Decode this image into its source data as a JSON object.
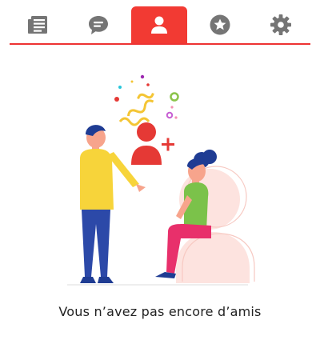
{
  "tabs": [
    {
      "id": "news",
      "icon": "newspaper-icon",
      "active": false
    },
    {
      "id": "messages",
      "icon": "chat-bubble-icon",
      "active": false
    },
    {
      "id": "friends",
      "icon": "user-icon",
      "active": true
    },
    {
      "id": "favorites",
      "icon": "star-icon",
      "active": false
    },
    {
      "id": "settings",
      "icon": "gear-icon",
      "active": false
    }
  ],
  "colors": {
    "accent": "#f23a33",
    "icon_inactive": "#757575",
    "icon_active": "#ffffff",
    "text": "#222222"
  },
  "empty_state": {
    "message": "Vous n’avez pas encore d’amis"
  }
}
